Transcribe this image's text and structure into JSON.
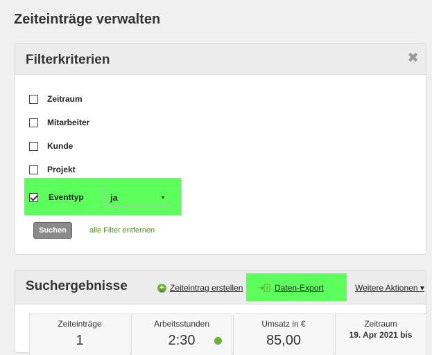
{
  "page": {
    "title": "Zeiteinträge verwalten"
  },
  "filter": {
    "title": "Filterkriterien",
    "close_symbol": "✖",
    "items": [
      {
        "label": "Zeitraum",
        "checked": false
      },
      {
        "label": "Mitarbeiter",
        "checked": false
      },
      {
        "label": "Kunde",
        "checked": false
      },
      {
        "label": "Projekt",
        "checked": false
      }
    ],
    "eventtyp": {
      "label": "Eventtyp",
      "checked": true,
      "selected": "ja"
    },
    "search_label": "Suchen",
    "remove_filters_label": "alle Filter entfernen"
  },
  "results": {
    "title": "Suchergebnisse",
    "create_entry_label": "Zeiteintrag erstellen",
    "export_label": "Daten-Export",
    "more_actions_label": "Weitere Aktionen ▾",
    "stats": [
      {
        "label": "Zeiteinträge",
        "value": "1"
      },
      {
        "label": "Arbeitsstunden",
        "value": "2:30"
      },
      {
        "label": "Umsatz in €",
        "value": "85,00"
      },
      {
        "label": "Zeitraum",
        "value": "19. Apr 2021 bis"
      }
    ]
  },
  "colors": {
    "highlight": "#5cff5c",
    "accent_green": "#6ab42f",
    "link_green": "#4f8f1c"
  }
}
